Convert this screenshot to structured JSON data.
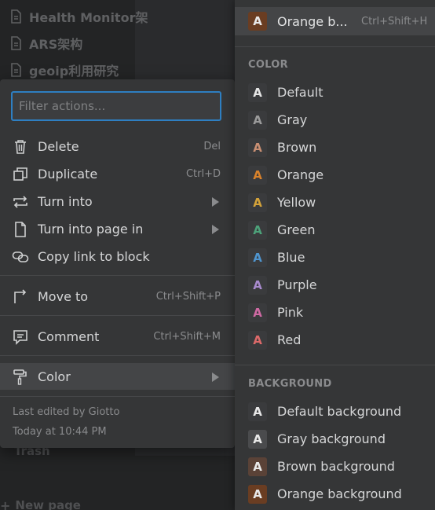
{
  "sidebar": {
    "pages": [
      {
        "title": "Health Monitor架"
      },
      {
        "title": "ARS架构"
      },
      {
        "title": "geoip利用研究"
      }
    ],
    "trash_label": "Trash",
    "new_page_label": "New page"
  },
  "actions_menu": {
    "filter_placeholder": "Filter actions...",
    "items": [
      {
        "label": "Delete",
        "shortcut": "Del"
      },
      {
        "label": "Duplicate",
        "shortcut": "Ctrl+D"
      },
      {
        "label": "Turn into",
        "shortcut": ""
      },
      {
        "label": "Turn into page in",
        "shortcut": ""
      },
      {
        "label": "Copy link to block",
        "shortcut": ""
      },
      {
        "label": "Move to",
        "shortcut": "Ctrl+Shift+P"
      },
      {
        "label": "Comment",
        "shortcut": "Ctrl+Shift+M"
      },
      {
        "label": "Color",
        "shortcut": ""
      }
    ],
    "last_edited": "Last edited by Giotto",
    "last_edited_time": "Today at 10:44 PM"
  },
  "color_menu": {
    "current": {
      "glyph": "A",
      "label": "Orange b...",
      "shortcut": "Ctrl+Shift+H"
    },
    "color_heading": "COLOR",
    "colors": [
      {
        "glyph": "A",
        "label": "Default",
        "color": "#e6e6e6"
      },
      {
        "glyph": "A",
        "label": "Gray",
        "color": "#9b9b9b"
      },
      {
        "glyph": "A",
        "label": "Brown",
        "color": "#c98f73"
      },
      {
        "glyph": "A",
        "label": "Orange",
        "color": "#d9822b"
      },
      {
        "glyph": "A",
        "label": "Yellow",
        "color": "#d4a33a"
      },
      {
        "glyph": "A",
        "label": "Green",
        "color": "#4da27a"
      },
      {
        "glyph": "A",
        "label": "Blue",
        "color": "#4f95cf"
      },
      {
        "glyph": "A",
        "label": "Purple",
        "color": "#a98bce"
      },
      {
        "glyph": "A",
        "label": "Pink",
        "color": "#d06aa4"
      },
      {
        "glyph": "A",
        "label": "Red",
        "color": "#dd6a6a"
      }
    ],
    "background_heading": "BACKGROUND",
    "backgrounds": [
      {
        "glyph": "A",
        "label": "Default background",
        "bg": "#3a3b3d"
      },
      {
        "glyph": "A",
        "label": "Gray background",
        "bg": "#4a4b4d"
      },
      {
        "glyph": "A",
        "label": "Brown background",
        "bg": "#5a4237"
      },
      {
        "glyph": "A",
        "label": "Orange background",
        "bg": "#6a3d22"
      }
    ]
  },
  "colors": {
    "accent": "#2e7fc2",
    "menu_bg": "#353637",
    "hover_bg": "#444547"
  }
}
